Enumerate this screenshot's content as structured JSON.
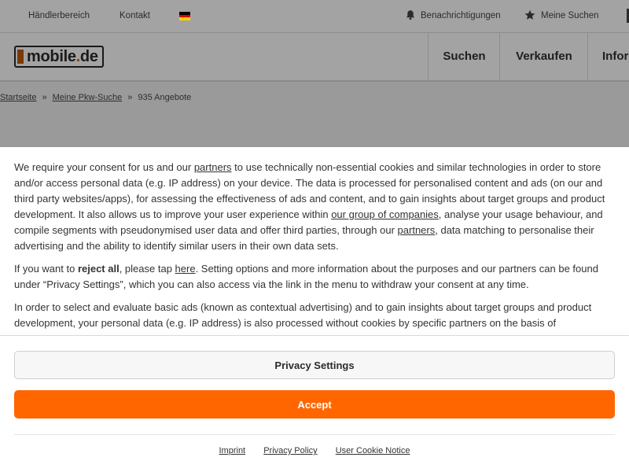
{
  "topbar": {
    "dealer_area": "Händlerbereich",
    "contact": "Kontakt",
    "notifications": "Benachrichtigungen",
    "my_searches": "Meine Suchen",
    "flag_colors": [
      "#000000",
      "#dd0000",
      "#ffce00"
    ]
  },
  "header": {
    "logo_text": "mobile",
    "logo_dot": ".",
    "logo_tld": "de",
    "nav": [
      "Suchen",
      "Verkaufen",
      "Infor"
    ]
  },
  "breadcrumb": {
    "home": "Startseite",
    "search": "Meine Pkw-Suche",
    "offers": "935 Angebote",
    "separator": "»"
  },
  "consent": {
    "p1_a": "We require your consent for us and our ",
    "p1_link1": "partners",
    "p1_b": " to use technically non-essential cookies and similar technologies in order to store and/or access personal data (e.g. IP address) on your device. The data is processed for personalised content and ads (on our and third party websites/apps), for assessing the effectiveness of ads and content, and to gain insights about target groups and product development. It also allows us to improve your user experience within ",
    "p1_link2": "our group of companies",
    "p1_c": ", analyse your usage behaviour, and compile segments with pseudonymised user data and offer third parties, through our ",
    "p1_link3": "partners",
    "p1_d": ", data matching to personalise their advertising and the ability to identify similar users in their own data sets.",
    "p2_a": "If you want to ",
    "p2_bold": "reject all",
    "p2_b": ", please tap ",
    "p2_link": "here",
    "p2_c": ". Setting options and more information about the purposes and our partners can be found under “Privacy Settings”, which you can also access via the link in the menu to withdraw your consent at any time.",
    "p3": "In order to select and evaluate basic ads (known as contextual advertising) and to gain insights about target groups and product development, your personal data (e.g. IP address) is also processed without cookies by specific partners on the basis of",
    "privacy_settings_label": "Privacy Settings",
    "accept_label": "Accept",
    "accent_color": "#ff6600"
  },
  "footer": {
    "imprint": "Imprint",
    "privacy_policy": "Privacy Policy",
    "user_cookie_notice": "User Cookie Notice"
  }
}
